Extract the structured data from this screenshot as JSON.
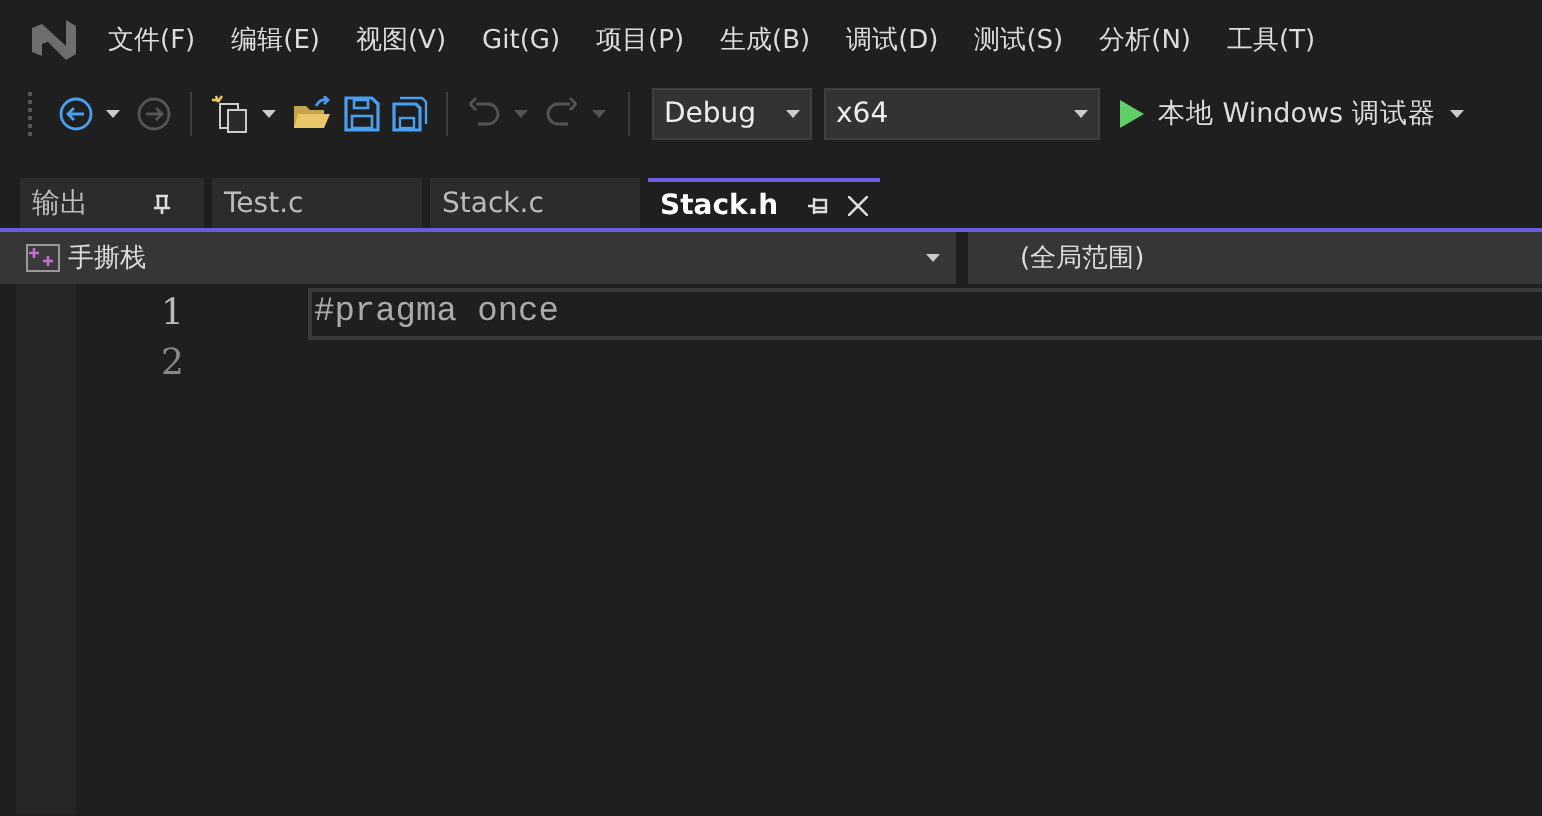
{
  "menu": [
    "文件(F)",
    "编辑(E)",
    "视图(V)",
    "Git(G)",
    "项目(P)",
    "生成(B)",
    "调试(D)",
    "测试(S)",
    "分析(N)",
    "工具(T)"
  ],
  "toolbar": {
    "configuration": "Debug",
    "platform": "x64",
    "run_label": "本地 Windows 调试器"
  },
  "tabs": [
    {
      "label": "输出",
      "selected": false,
      "pinned": true
    },
    {
      "label": "Test.c",
      "selected": false,
      "pinned": false
    },
    {
      "label": "Stack.c",
      "selected": false,
      "pinned": false
    },
    {
      "label": "Stack.h",
      "selected": true,
      "pinned": true
    }
  ],
  "navigation": {
    "project": "手撕栈",
    "scope": "(全局范围)"
  },
  "editor": {
    "lines": [
      {
        "number": "1",
        "text": "#pragma once",
        "current": true
      },
      {
        "number": "2",
        "current": false
      }
    ]
  }
}
